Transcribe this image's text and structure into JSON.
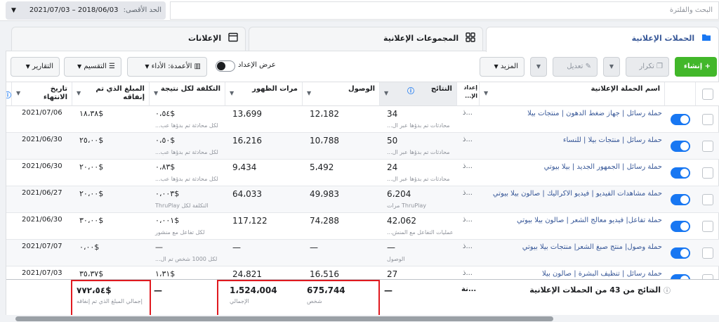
{
  "topbar": {
    "search_placeholder": "البحث والفلترة",
    "date_label": "الحد الأقصى:",
    "date_range": "2018/06/03 – 2021/07/03"
  },
  "tabs": [
    {
      "label": "الحملات الإعلانية",
      "active": true
    },
    {
      "label": "المجموعات الإعلانية",
      "active": false
    },
    {
      "label": "الإعلانات",
      "active": false
    }
  ],
  "toolbar": {
    "create": "إنشاء",
    "duplicate": "تكرار",
    "edit": "تعديل",
    "more": "المزيد",
    "view_setup": "عرض الإعداد",
    "columns": "الأعمدة: الأداء",
    "breakdown": "التقسيم",
    "reports": "التقارير"
  },
  "columns": {
    "name": "اسم الحملة الإعلانية",
    "delivery": "إعداد الإ...",
    "results": "النتائج",
    "reach": "الوصول",
    "impressions": "مرات الظهور",
    "cost_per_result": "التكلفة لكل نتيجة",
    "amount_spent": "المبلغ الذي تم إنفاقه",
    "end_date": "تاريخ الانتهاء"
  },
  "rows": [
    {
      "name": "حملة رسائل | جهاز ضغط الدهون | منتجات بيلا",
      "delivery": "ذ...",
      "results": "34",
      "results_sub": "محادثات تم بدؤها عبر ال...",
      "reach": "12،182",
      "impressions": "13،699",
      "cpr": "٠،٥٤$",
      "cpr_sub": "لكل محادثة تم بدؤها عب...",
      "spent": "١٨،٣٨$",
      "end": "2021/07/06"
    },
    {
      "name": "حملة رسائل | منتجات بيلا | للنساء",
      "delivery": "ذ...",
      "results": "50",
      "results_sub": "محادثات تم بدؤها عبر ال...",
      "reach": "10،788",
      "impressions": "16،216",
      "cpr": "٠،٥٠$",
      "cpr_sub": "لكل محادثة تم بدؤها عب...",
      "spent": "٢٥،٠٠$",
      "end": "2021/06/30"
    },
    {
      "name": "حملة رسائل | الجمهور الجديد | بيلا بيوتي",
      "delivery": "ذ...",
      "results": "24",
      "results_sub": "محادثات تم بدؤها عبر ال...",
      "reach": "5،492",
      "impressions": "9،434",
      "cpr": "٠،٨٣$",
      "cpr_sub": "لكل محادثة تم بدؤها عب...",
      "spent": "٢٠،٠٠$",
      "end": "2021/06/30"
    },
    {
      "name": "حملة مشاهدات الفيديو | فيديو الاكراليك | صالون بيلا بيوتي",
      "delivery": "ذ...",
      "results": "6،204",
      "results_sub": "ThruPlay مرات",
      "reach": "49،983",
      "impressions": "64،033",
      "cpr": "٠،٠٠٣$",
      "cpr_sub": "التكلفة لكل ThruPlay",
      "spent": "٢٠،٠٠$",
      "end": "2021/06/27"
    },
    {
      "name": "حملة تفاعل| فيديو معالج الشعر | صالون بيلا بيوتي",
      "delivery": "ذ...",
      "results": "42،062",
      "results_sub": "عمليات التفاعل مع المنش...",
      "reach": "74،288",
      "impressions": "117،122",
      "cpr": "٠،٠٠١$",
      "cpr_sub": "لكل تفاعل مع منشور",
      "spent": "٣٠،٠٠$",
      "end": "2021/06/30"
    },
    {
      "name": "حملة وصول| منتج صبغ الشعر| منتجات بيلا بيوتي",
      "delivery": "ذ...",
      "results": "—",
      "results_sub": "الوصول",
      "reach": "—",
      "impressions": "—",
      "cpr": "—",
      "cpr_sub": "لكل 1000 شخص تم ال...",
      "spent": "٠،٠٠$",
      "end": "2021/07/07"
    },
    {
      "name": "حملة رسائل | تنظيف البشرة | صالون بيلا",
      "delivery": "ذ...",
      "results": "27",
      "results_sub": "",
      "reach": "16،516",
      "impressions": "24،821",
      "cpr": "١،٣١$",
      "cpr_sub": "",
      "spent": "٣٥،٣٧$",
      "end": "2021/07/03"
    }
  ],
  "summary": {
    "label": "النتائج من 43 من الحملات الإعلانية",
    "delivery": "نة...",
    "results": "—",
    "reach": "675،744",
    "reach_sub": "شخص",
    "impressions": "1،524،004",
    "impressions_sub": "الإجمالي",
    "cpr": "—",
    "spent": "٧٧٢،٥٤$",
    "spent_sub": "إجمالي المبلغ الذي تم إنفاقه"
  },
  "colors": {
    "accent": "#1877f2",
    "create": "#42b72a",
    "highlight": "#e0191f",
    "link": "#385898"
  }
}
